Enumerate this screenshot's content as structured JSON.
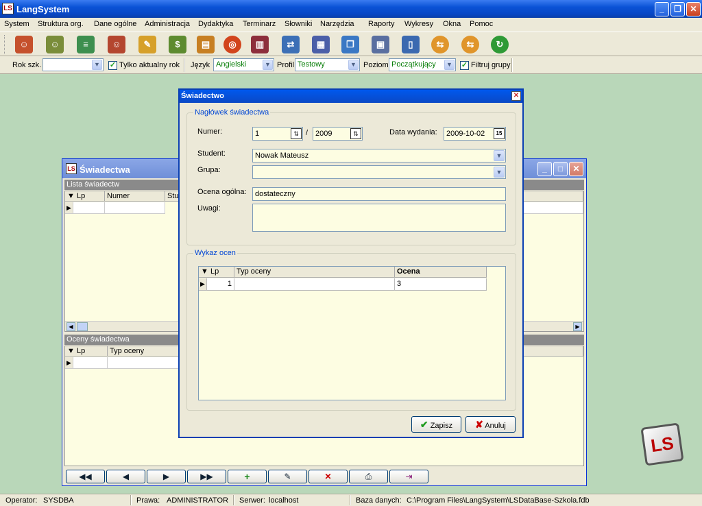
{
  "app": {
    "title": "LangSystem",
    "logo": "LS"
  },
  "menu": [
    "System",
    "Struktura org.",
    "Dane ogólne",
    "Administracja",
    "Dydaktyka",
    "Terminarz",
    "Słowniki",
    "Narzędzia",
    "Raporty",
    "Wykresy",
    "Okna",
    "Pomoc"
  ],
  "toolbar_icons": [
    "people-icon",
    "teacher-icon",
    "books-stack-icon",
    "student-icon",
    "notebook-icon",
    "money-bag-icon",
    "clipboard-icon",
    "target-icon",
    "book-icon",
    "exchange-icon",
    "journal-icon",
    "copy-icon",
    "windows-icon",
    "columns-icon",
    "sync-left-icon",
    "sync-right-icon",
    "refresh-icon"
  ],
  "filters": {
    "year_label": "Rok szk.",
    "year_value": "",
    "only_current_label": "Tylko aktualny rok",
    "language_label": "Język",
    "language_value": "Angielski",
    "profile_label": "Profil",
    "profile_value": "Testowy",
    "level_label": "Poziom",
    "level_value": "Początkujący",
    "filter_groups_label": "Filtruj grupy"
  },
  "child_window": {
    "title": "Świadectwa",
    "logo": "LS",
    "list_header": "Lista świadectw",
    "list_columns": [
      "Lp",
      "Numer",
      "Stud"
    ],
    "grades_header": "Oceny świadectwa",
    "grades_columns": [
      "Lp",
      "Typ oceny"
    ]
  },
  "dialog": {
    "title": "Świadectwo",
    "header_group": "Nagłówek świadectwa",
    "number_label": "Numer:",
    "number_value": "1",
    "separator": "/",
    "year_value": "2009",
    "issue_date_label": "Data wydania:",
    "issue_date_value": "2009-10-02",
    "calendar_day": "15",
    "student_label": "Student:",
    "student_value": "Nowak Mateusz",
    "group_label": "Grupa:",
    "group_value": "",
    "overall_label": "Ocena ogólna:",
    "overall_value": "dostateczny",
    "notes_label": "Uwagi:",
    "notes_value": "",
    "grades_group": "Wykaz ocen",
    "grades_columns": [
      "Lp",
      "Typ oceny",
      "Ocena"
    ],
    "grades_rows": [
      {
        "lp": "1",
        "type": "",
        "grade": "3"
      }
    ],
    "save_label": "Zapisz",
    "cancel_label": "Anuluj"
  },
  "status": {
    "operator_label": "Operator:",
    "operator_value": "SYSDBA",
    "rights_label": "Prawa:",
    "rights_value": "ADMINISTRATOR",
    "server_label": "Serwer:",
    "server_value": "localhost",
    "db_label": "Baza danych:",
    "db_value": "C:\\Program Files\\LangSystem\\LSDataBase-Szkola.fdb"
  }
}
